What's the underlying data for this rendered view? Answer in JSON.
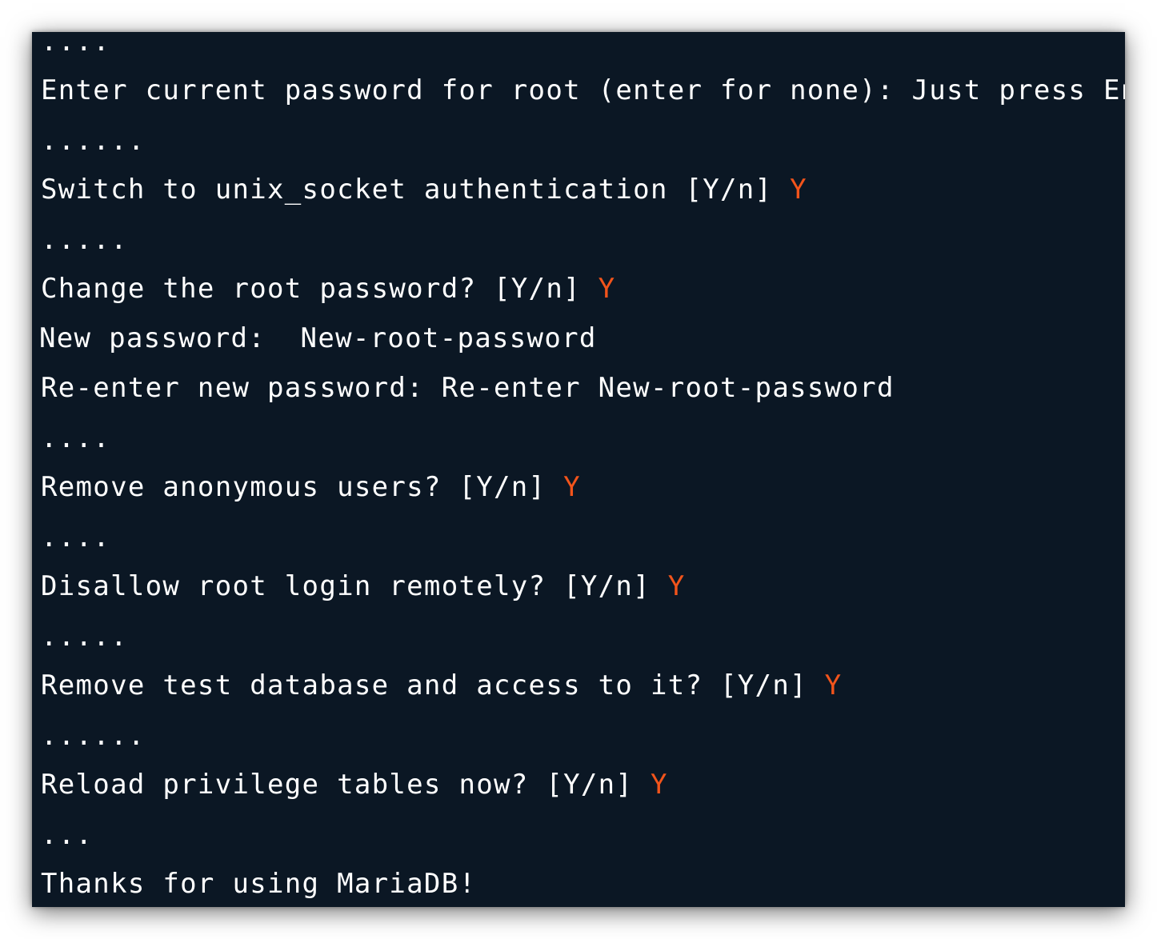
{
  "colors": {
    "background": "#0b1724",
    "text": "#ffffff",
    "answer": "#f2541b"
  },
  "terminal": {
    "lines": [
      {
        "text": "....",
        "answer": ""
      },
      {
        "text": "Enter current password for root (enter for none): Just press Enter",
        "answer": ""
      },
      {
        "text": "......",
        "answer": ""
      },
      {
        "text": "Switch to unix_socket authentication [Y/n] ",
        "answer": "Y"
      },
      {
        "text": ".....",
        "answer": ""
      },
      {
        "text": "Change the root password? [Y/n] ",
        "answer": "Y"
      },
      {
        "text": "New password:  New-root-password",
        "answer": ""
      },
      {
        "text": "Re-enter new password: Re-enter New-root-password",
        "answer": ""
      },
      {
        "text": "....",
        "answer": ""
      },
      {
        "text": "Remove anonymous users? [Y/n] ",
        "answer": "Y"
      },
      {
        "text": "....",
        "answer": ""
      },
      {
        "text": "Disallow root login remotely? [Y/n] ",
        "answer": "Y"
      },
      {
        "text": ".....",
        "answer": ""
      },
      {
        "text": "Remove test database and access to it? [Y/n] ",
        "answer": "Y"
      },
      {
        "text": "......",
        "answer": ""
      },
      {
        "text": "Reload privilege tables now? [Y/n] ",
        "answer": "Y"
      },
      {
        "text": "...",
        "answer": ""
      },
      {
        "text": "Thanks for using MariaDB!",
        "answer": ""
      }
    ]
  }
}
